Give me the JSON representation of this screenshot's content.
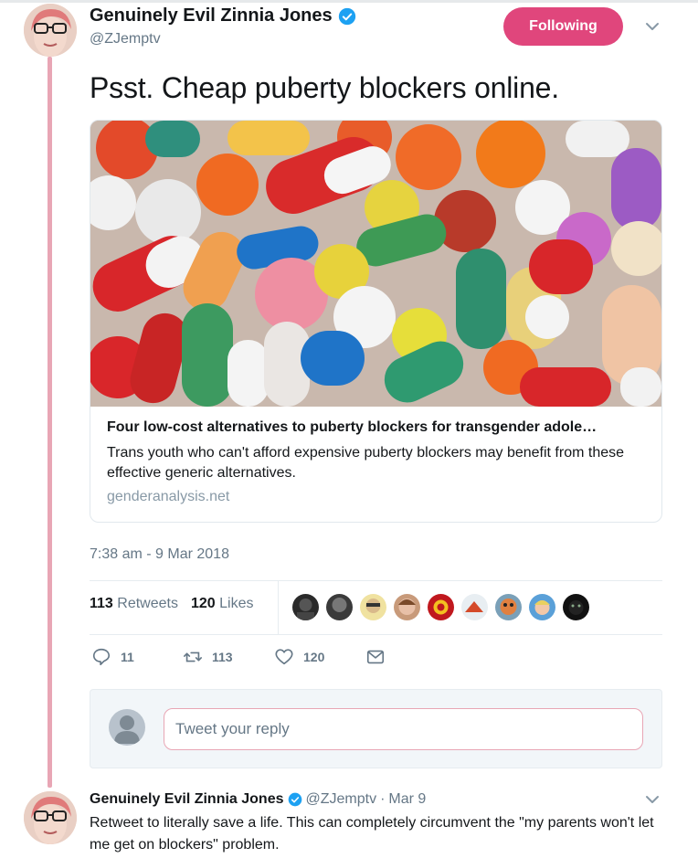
{
  "tweet": {
    "display_name": "Genuinely Evil Zinnia Jones",
    "handle": "@ZJemptv",
    "follow_label": "Following",
    "text": "Psst. Cheap puberty blockers online.",
    "card": {
      "title": "Four low-cost alternatives to puberty blockers for transgender adole…",
      "description": "Trans youth who can't afford expensive puberty blockers may benefit from these effective generic alternatives.",
      "domain": "genderanalysis.net"
    },
    "timestamp": "7:38 am - 9 Mar 2018",
    "stats": {
      "retweets_count": "113",
      "retweets_label": "Retweets",
      "likes_count": "120",
      "likes_label": "Likes"
    },
    "liker_avatars": [
      "liker-1",
      "liker-2",
      "liker-3",
      "liker-4",
      "liker-5",
      "liker-6",
      "liker-7",
      "liker-8",
      "liker-9"
    ],
    "actions": {
      "reply_count": "11",
      "retweet_count": "113",
      "like_count": "120"
    }
  },
  "reply_box": {
    "placeholder": "Tweet your reply"
  },
  "next_tweet": {
    "display_name": "Genuinely Evil Zinnia Jones",
    "handle": "@ZJemptv",
    "separator": "·",
    "date": "Mar 9",
    "text": "Retweet to literally save a life. This can completely circumvent the \"my parents won't let me get on blockers\" problem."
  },
  "colors": {
    "accent": "#e0467c",
    "thread_line": "#e8a6b5",
    "muted_text": "#657786",
    "verified": "#1da1f2"
  },
  "icons": {
    "verified": "verified-badge-icon",
    "chevron": "chevron-down-icon",
    "reply": "reply-icon",
    "retweet": "retweet-icon",
    "like": "heart-icon",
    "dm": "envelope-icon"
  }
}
